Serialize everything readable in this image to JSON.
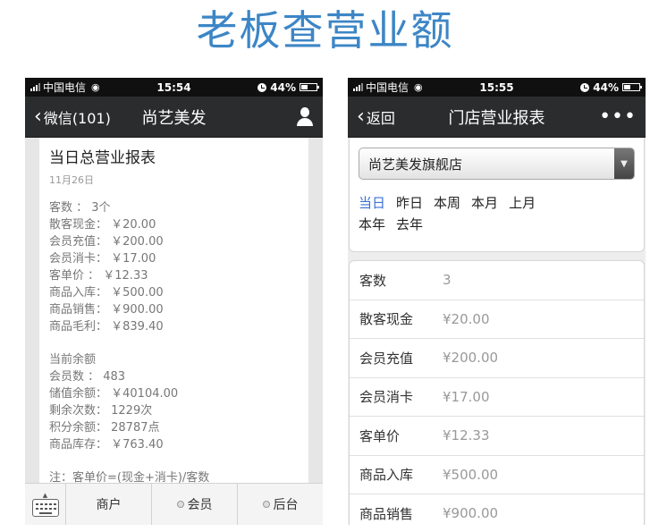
{
  "headline": "老板查营业额",
  "phone1": {
    "status": {
      "carrier": "中国电信",
      "time": "15:54",
      "battery": "44%",
      "battery_level": 0.44
    },
    "nav": {
      "back_label": "微信(101)",
      "title": "尚艺美发",
      "action_icon": "user-icon"
    },
    "report": {
      "title": "当日总营业报表",
      "date": "11月26日",
      "lines_a": [
        "客数 ： 3个",
        "散客现金： ￥20.00",
        "会员充值： ￥200.00",
        "会员消卡： ￥17.00",
        "客单价 ： ￥12.33",
        "商品入库： ￥500.00",
        "商品销售： ￥900.00",
        "商品毛利： ￥839.40"
      ],
      "lines_b": [
        "当前余额",
        "会员数 ： 483",
        "储值余额： ￥40104.00",
        "剩余次数： 1229次",
        "积分余额： 28787点",
        "商品库存： ￥763.40"
      ],
      "note": "注：客单价=(现金+消卡)/客数"
    },
    "tabbar": {
      "keyboard_icon": "keyboard-icon",
      "tabs": [
        "商户",
        "会员",
        "后台"
      ]
    }
  },
  "phone2": {
    "status": {
      "carrier": "中国电信",
      "time": "15:55",
      "battery": "44%",
      "battery_level": 0.44
    },
    "nav": {
      "back_label": "返回",
      "title": "门店营业报表",
      "action_icon": "more-icon"
    },
    "store_select": {
      "value": "尚艺美发旗舰店"
    },
    "periods": [
      "当日",
      "昨日",
      "本周",
      "本月",
      "上月",
      "本年",
      "去年"
    ],
    "active_period": "当日",
    "rows": [
      {
        "label": "客数",
        "value": "3"
      },
      {
        "label": "散客现金",
        "value": "¥20.00"
      },
      {
        "label": "会员充值",
        "value": "¥200.00"
      },
      {
        "label": "会员消卡",
        "value": "¥17.00"
      },
      {
        "label": "客单价",
        "value": "¥12.33"
      },
      {
        "label": "商品入库",
        "value": "¥500.00"
      },
      {
        "label": "商品销售",
        "value": "¥900.00"
      }
    ]
  }
}
